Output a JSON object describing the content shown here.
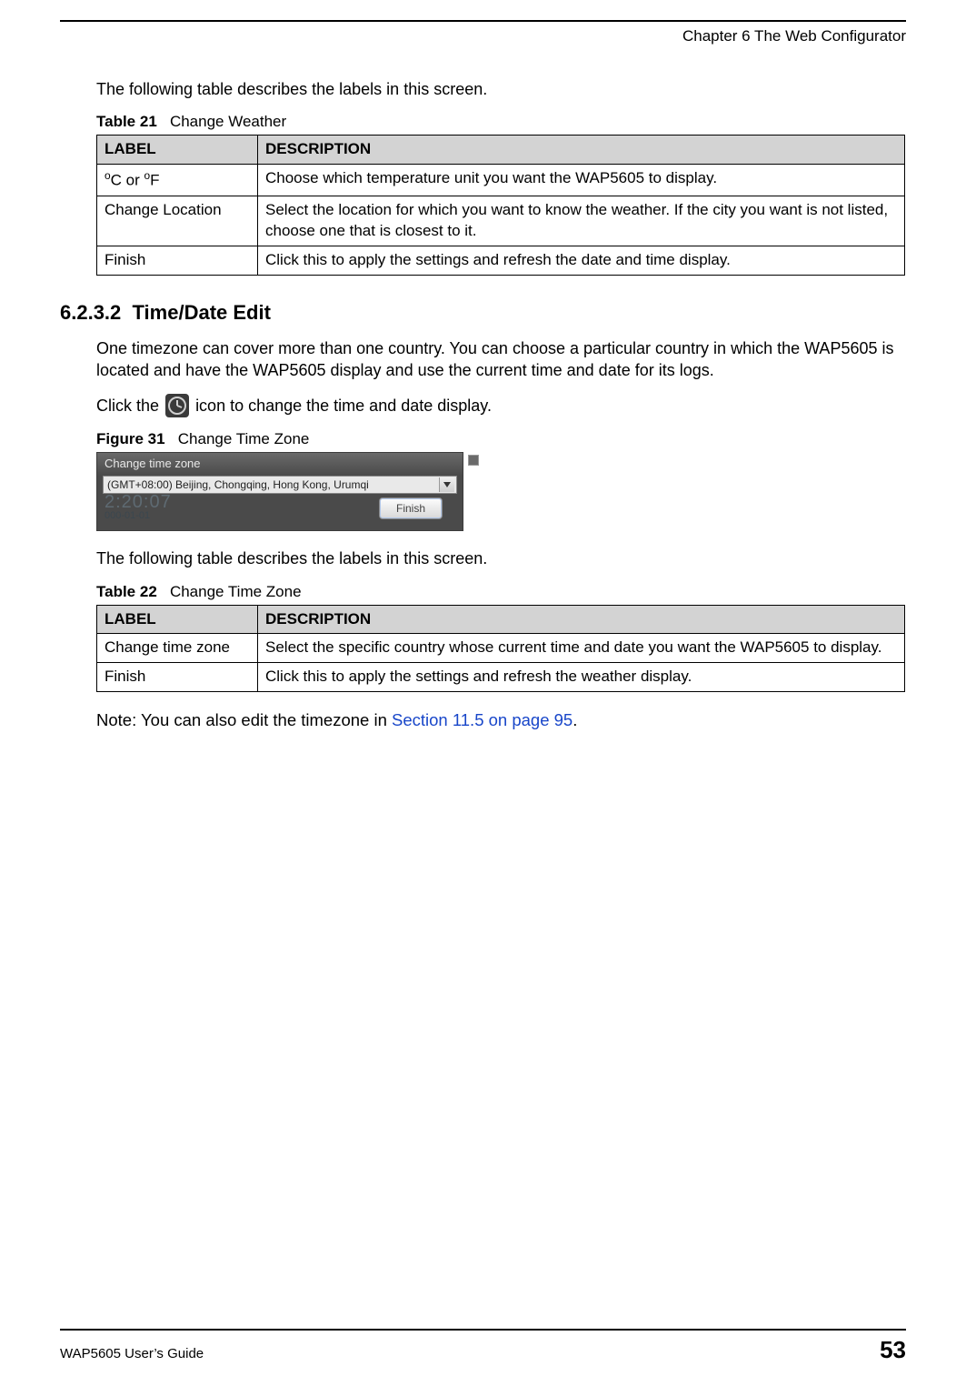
{
  "header": {
    "chapter": "Chapter 6 The Web Configurator"
  },
  "intro1": "The following table describes the labels in this screen.",
  "table21": {
    "caption_label": "Table 21",
    "caption_text": "Change Weather",
    "head_label": "LABEL",
    "head_desc": "DESCRIPTION",
    "rows": [
      {
        "label_html": "<sup>o</sup>C or <sup>o</sup>F",
        "desc": "Choose which temperature unit you want the WAP5605 to display."
      },
      {
        "label": "Change Location",
        "desc": "Select the location for which you want to know the weather. If the city you want is not listed, choose one that is closest to it."
      },
      {
        "label": "Finish",
        "desc": "Click this to apply the settings and refresh the date and time display."
      }
    ]
  },
  "section": {
    "number": "6.2.3.2",
    "title": "Time/Date Edit"
  },
  "para1": "One timezone can cover more than one country. You can choose a particular country in which the WAP5605 is located and have the WAP5605 display and use the current time and date for its logs.",
  "para2_pre": "Click the",
  "para2_post": "icon to change the time and date display.",
  "figure31": {
    "caption_label": "Figure 31",
    "caption_text": "Change Time Zone",
    "window_title": "Change time zone",
    "select_value": "(GMT+08:00) Beijing, Chongqing, Hong Kong, Urumqi",
    "faded_time": "2:20:07",
    "faded_date": "000-01-01",
    "finish_label": "Finish"
  },
  "intro2": "The following table describes the labels in this screen.",
  "table22": {
    "caption_label": "Table 22",
    "caption_text": "Change  Time Zone",
    "head_label": "LABEL",
    "head_desc": "DESCRIPTION",
    "rows": [
      {
        "label": "Change time zone",
        "desc": "Select the specific country whose current time and date you want the WAP5605 to display."
      },
      {
        "label": "Finish",
        "desc": "Click this to apply the settings and refresh the weather display."
      }
    ]
  },
  "note": {
    "prefix": "Note: You can also edit the timezone in ",
    "link": "Section 11.5 on page 95",
    "suffix": "."
  },
  "footer": {
    "guide": "WAP5605 User’s Guide",
    "page_number": "53"
  }
}
